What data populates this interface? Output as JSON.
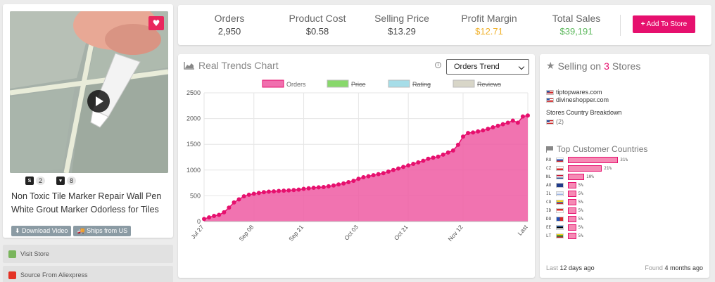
{
  "product": {
    "title": "Non Toxic Tile Marker Repair Wall Pen White Grout Marker Odorless for Tiles",
    "shopify_count": "2",
    "store_count": "8",
    "tags": [
      "Download Video",
      "Ships from US"
    ]
  },
  "sidebar": {
    "visit_store": "Visit Store",
    "source_aliexpress": "Source From Aliexpress"
  },
  "stats": {
    "orders_label": "Orders",
    "orders_value": "2,950",
    "cost_label": "Product Cost",
    "cost_value": "$0.58",
    "price_label": "Selling Price",
    "price_value": "$13.29",
    "margin_label": "Profit Margin",
    "margin_value": "$12.71",
    "sales_label": "Total Sales",
    "sales_value": "$39,191",
    "add_button": "Add To Store"
  },
  "colors": {
    "accent": "#e6106e",
    "margin": "#f0b12b",
    "sales": "#5cb85c"
  },
  "chart_panel": {
    "title": "Real Trends Chart",
    "select_value": "Orders Trend"
  },
  "chart_data": {
    "type": "area",
    "legend": [
      {
        "name": "Orders",
        "color": "#f06fae",
        "active": true
      },
      {
        "name": "Price",
        "color": "#88d86b",
        "active": false
      },
      {
        "name": "Rating",
        "color": "#a6dde8",
        "active": false
      },
      {
        "name": "Reviews",
        "color": "#d8d6c8",
        "active": false
      }
    ],
    "x_ticks": [
      "Jul 27",
      "Sep 08",
      "Sep 21",
      "Oct 03",
      "Oct 21",
      "Nov 12",
      "Last"
    ],
    "ylim": [
      0,
      2500
    ],
    "y_ticks": [
      0,
      500,
      1000,
      1500,
      2000,
      2500
    ],
    "values": [
      50,
      80,
      110,
      130,
      180,
      270,
      370,
      430,
      490,
      520,
      540,
      555,
      570,
      580,
      585,
      595,
      600,
      605,
      612,
      620,
      635,
      645,
      655,
      665,
      670,
      685,
      700,
      720,
      740,
      765,
      790,
      830,
      860,
      880,
      900,
      920,
      940,
      970,
      1000,
      1030,
      1060,
      1090,
      1120,
      1150,
      1180,
      1220,
      1240,
      1260,
      1300,
      1340,
      1380,
      1490,
      1650,
      1720,
      1730,
      1750,
      1770,
      1800,
      1830,
      1860,
      1890,
      1920,
      1960,
      1920,
      2040,
      2060
    ],
    "grid": true
  },
  "stores": {
    "title_prefix": "Selling on",
    "count": "3",
    "title_suffix": "Stores",
    "list": [
      "tiptopwares.com",
      "divineshopper.com"
    ],
    "breakdown_label": "Stores Country Breakdown",
    "breakdown_value": "(2)",
    "top_countries_title": "Top Customer Countries",
    "countries": [
      {
        "code": "RU",
        "pct": 31,
        "label": "31%"
      },
      {
        "code": "CZ",
        "pct": 21,
        "label": "21%"
      },
      {
        "code": "NL",
        "pct": 10,
        "label": "10%"
      },
      {
        "code": "AU",
        "pct": 5,
        "label": "5%"
      },
      {
        "code": "IL",
        "pct": 5,
        "label": "5%"
      },
      {
        "code": "CO",
        "pct": 5,
        "label": "5%"
      },
      {
        "code": "ID",
        "pct": 5,
        "label": "5%"
      },
      {
        "code": "DO",
        "pct": 5,
        "label": "5%"
      },
      {
        "code": "EE",
        "pct": 5,
        "label": "5%"
      },
      {
        "code": "LT",
        "pct": 5,
        "label": "5%"
      }
    ],
    "last_prefix": "Last",
    "last_value": "12 days ago",
    "found_prefix": "Found",
    "found_value": "4 months ago"
  }
}
